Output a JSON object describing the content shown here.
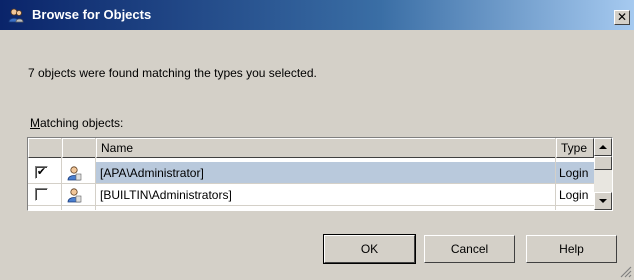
{
  "window": {
    "title": "Browse for Objects",
    "close_glyph": "✕"
  },
  "status_text": "7 objects were found matching the types you selected.",
  "list": {
    "label_accel": "M",
    "label_rest": "atching objects:",
    "columns": {
      "name": "Name",
      "type": "Type"
    },
    "rows": [
      {
        "checked": true,
        "check_glyph": "✔",
        "name": "[APA\\Administrator]",
        "type": "Login",
        "icon": "user-login-icon"
      },
      {
        "checked": false,
        "check_glyph": "",
        "name": "[BUILTIN\\Administrators]",
        "type": "Login",
        "icon": "user-login-icon"
      }
    ]
  },
  "buttons": {
    "ok": "OK",
    "cancel": "Cancel",
    "help": "Help"
  },
  "colors": {
    "title_start": "#0a246a",
    "title_end": "#a6caf0",
    "selection": "#b9c9dc",
    "face": "#d4d0c8"
  }
}
